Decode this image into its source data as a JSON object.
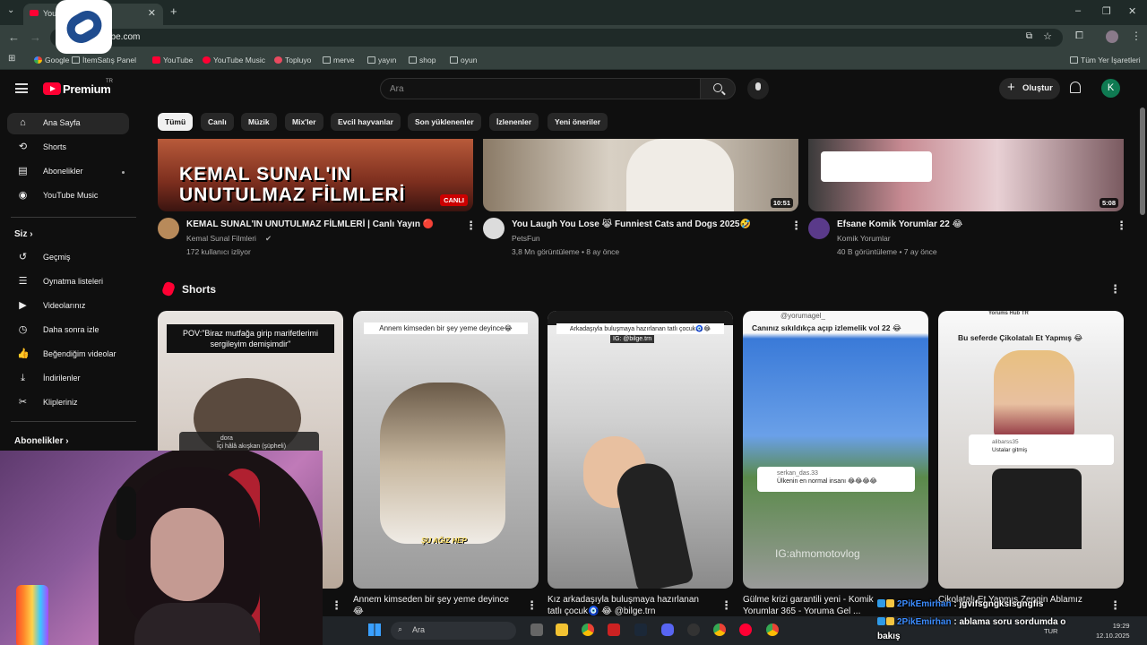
{
  "browser": {
    "tab_title": "You",
    "url": "youtube.com",
    "url_shown": "ube.com",
    "bookmarks": [
      "Google",
      "İtemSatış Panel",
      "YouTube",
      "YouTube Music",
      "Topluyo",
      "merve",
      "yayın",
      "shop",
      "oyun"
    ],
    "all_bookmarks": "Tüm Yer İşaretleri"
  },
  "header": {
    "logo": "Premium",
    "region": "TR",
    "search_placeholder": "Ara",
    "create_label": "Oluştur",
    "avatar_letter": "K"
  },
  "chips": [
    "Tümü",
    "Canlı",
    "Müzik",
    "Mix'ler",
    "Evcil hayvanlar",
    "Son yüklenenler",
    "İzlenenler",
    "Yeni öneriler"
  ],
  "sidebar": {
    "main": [
      "Ana Sayfa",
      "Shorts",
      "Abonelikler",
      "YouTube Music"
    ],
    "you_heading": "Siz",
    "you_items": [
      "Geçmiş",
      "Oynatma listeleri",
      "Videolarınız",
      "Daha sonra izle",
      "Beğendiğim videolar",
      "İndirilenler",
      "Klipleriniz"
    ],
    "subs_heading": "Abonelikler"
  },
  "videos": [
    {
      "title": "KEMAL SUNAL'IN UNUTULMAZ FİLMLERİ | Canlı Yayın 🔴",
      "channel": "Kemal Sunal Filmleri",
      "meta": "172 kullanıcı izliyor",
      "badge": "CANLI",
      "thumb_line1": "KEMAL SUNAL'IN",
      "thumb_line2": "UNUTULMAZ FİLMLERİ"
    },
    {
      "title": "You Laugh You Lose 😹 Funniest Cats and Dogs 2025🤣",
      "channel": "PetsFun",
      "meta": "3,8 Mn görüntüleme • 8 ay önce",
      "duration": "10:51"
    },
    {
      "title": "Efsane Komik Yorumlar 22 😂",
      "channel": "Komik Yorumlar",
      "meta": "40 B görüntüleme • 7 ay önce",
      "duration": "5:08"
    }
  ],
  "shorts": {
    "heading": "Shorts",
    "items": [
      {
        "title": "",
        "overlay": "POV:\"Biraz mutfağa girip marifetlerimi sergileyim demişimdir\"",
        "comment_user": "_dora",
        "comment_text": "İçi hâlâ akışkan (şüpheli)"
      },
      {
        "title": "Annem kimseden bir şey yeme deyince😂",
        "overlay": "Annem kimseden bir şey yeme deyince😂",
        "caption": "ŞU AĞIZ HEP"
      },
      {
        "title": "Kız arkadaşıyla buluşmaya hazırlanan tatlı çocuk🧿 😂 @bilge.trn",
        "overlay": "Arkadaşıyla buluşmaya hazırlanan tatlı çocuk🧿😂",
        "tag": "IG: @bilge.trn"
      },
      {
        "title": "Gülme krizi garantili yeni - Komik Yorumlar 365 - Yoruma Gel ...",
        "overlay": "Canınız sıkıldıkça açıp izlemelik vol 22 😂",
        "account": "@yorumagel_",
        "comment_user": "serkan_das.33",
        "comment_text": "Ülkenin en normal insanı 😂😂😂😂",
        "watermark": "IG:ahmomotovlog"
      },
      {
        "title": "Çikolatalı Et Yapmış Zengin Ablamız",
        "overlay": "Bu seferde Çikolatalı Et Yapmış 😂",
        "account": "Yorums Hub TR",
        "comment_user": "alibarss35",
        "comment_text": "Ustalar gitmiş"
      }
    ]
  },
  "taskbar": {
    "search": "Ara",
    "lang": "TUR",
    "time": "19:29",
    "date": "12.10.2025"
  },
  "chat": [
    {
      "user": "2PikEmirhan",
      "text": "jgvifsgngksİsgngfis"
    },
    {
      "user": "2PikEmirhan",
      "text": "ablama soru sordumda o",
      "text2": "bakış"
    }
  ]
}
